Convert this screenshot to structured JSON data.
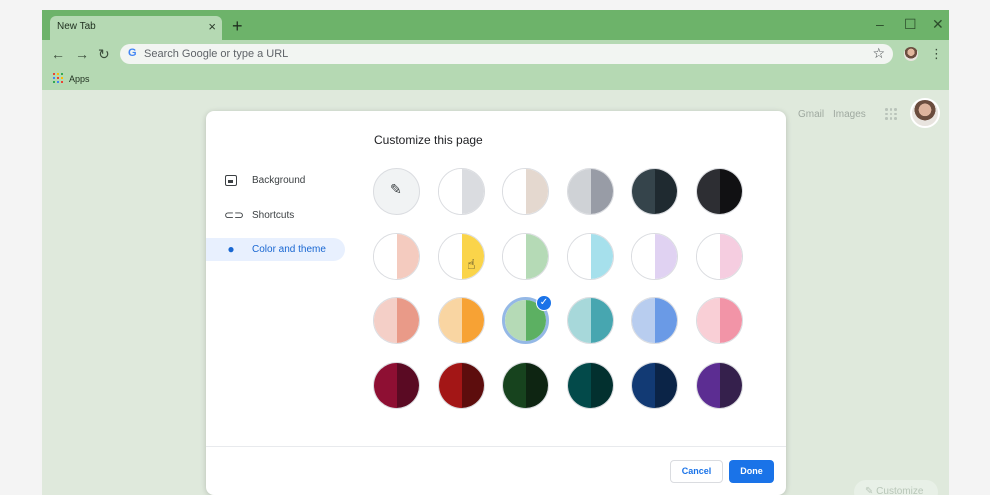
{
  "browser": {
    "tab_title": "New Tab",
    "tab_close": "×",
    "new_tab": "+",
    "omnibox_placeholder": "Search Google or type a URL",
    "bookmarks": {
      "apps_label": "Apps"
    },
    "frame_color": "#6db36a",
    "toolbar_color": "#b5d9b3"
  },
  "ntp": {
    "links": [
      "Gmail",
      "Images"
    ],
    "customize_label": "Customize"
  },
  "dialog": {
    "title": "Customize this page",
    "nav": [
      {
        "label": "Background",
        "icon": "image-icon"
      },
      {
        "label": "Shortcuts",
        "icon": "link-icon"
      },
      {
        "label": "Color and theme",
        "icon": "palette-icon",
        "selected": true
      }
    ],
    "cancel_label": "Cancel",
    "done_label": "Done",
    "accent": "#1a73e8"
  },
  "themes": [
    {
      "name": "custom",
      "left": "#f1f3f4",
      "right": "#f1f3f4",
      "custom": true
    },
    {
      "name": "default-grey",
      "left": "#ffffff",
      "right": "#dadce0"
    },
    {
      "name": "warm-grey",
      "left": "#ffffff",
      "right": "#e4d8cf"
    },
    {
      "name": "cool-grey",
      "left": "#cfd2d6",
      "right": "#989ca6"
    },
    {
      "name": "slate",
      "left": "#35444b",
      "right": "#1f2a30"
    },
    {
      "name": "black",
      "left": "#2d2e33",
      "right": "#111113"
    },
    {
      "name": "peach",
      "left": "#ffffff",
      "right": "#f4cbbf"
    },
    {
      "name": "yellow",
      "left": "#ffffff",
      "right": "#fad44a"
    },
    {
      "name": "mint",
      "left": "#ffffff",
      "right": "#b5dab6"
    },
    {
      "name": "sky",
      "left": "#ffffff",
      "right": "#a6e0ec"
    },
    {
      "name": "lavender",
      "left": "#ffffff",
      "right": "#e0d2f2"
    },
    {
      "name": "pink",
      "left": "#ffffff",
      "right": "#f5cde0"
    },
    {
      "name": "salmon",
      "left": "#f4cfc7",
      "right": "#e99a88"
    },
    {
      "name": "orange",
      "left": "#f9d5a2",
      "right": "#f7a234"
    },
    {
      "name": "green",
      "left": "#b5dab6",
      "right": "#5cb062",
      "selected": true
    },
    {
      "name": "teal",
      "left": "#a7d8da",
      "right": "#47a6b0"
    },
    {
      "name": "blue",
      "left": "#b8cdef",
      "right": "#6a9ae6"
    },
    {
      "name": "rose",
      "left": "#f9cfd6",
      "right": "#f294a7"
    },
    {
      "name": "crimson",
      "left": "#8e0f33",
      "right": "#5a0a23"
    },
    {
      "name": "maroon",
      "left": "#a31616",
      "right": "#5d0d0d"
    },
    {
      "name": "forest",
      "left": "#17431e",
      "right": "#0e2512"
    },
    {
      "name": "dark-teal",
      "left": "#034a4a",
      "right": "#02302f"
    },
    {
      "name": "navy",
      "left": "#123a74",
      "right": "#0b2447"
    },
    {
      "name": "purple",
      "left": "#5c2d92",
      "right": "#35204c"
    }
  ]
}
